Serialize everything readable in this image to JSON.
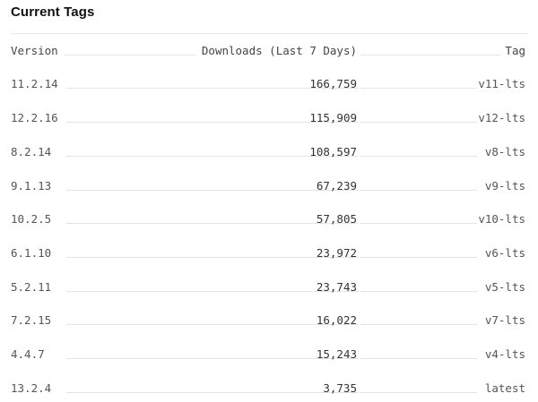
{
  "section": {
    "title": "Current Tags"
  },
  "table": {
    "columns": {
      "version": "Version",
      "downloads": "Downloads (Last 7 Days)",
      "tag": "Tag"
    },
    "rows": [
      {
        "version": "11.2.14",
        "downloads": "166,759",
        "tag": "v11-lts"
      },
      {
        "version": "12.2.16",
        "downloads": "115,909",
        "tag": "v12-lts"
      },
      {
        "version": "8.2.14",
        "downloads": "108,597",
        "tag": "v8-lts"
      },
      {
        "version": "9.1.13",
        "downloads": "67,239",
        "tag": "v9-lts"
      },
      {
        "version": "10.2.5",
        "downloads": "57,805",
        "tag": "v10-lts"
      },
      {
        "version": "6.1.10",
        "downloads": "23,972",
        "tag": "v6-lts"
      },
      {
        "version": "5.2.11",
        "downloads": "23,743",
        "tag": "v5-lts"
      },
      {
        "version": "7.2.15",
        "downloads": "16,022",
        "tag": "v7-lts"
      },
      {
        "version": "4.4.7",
        "downloads": "15,243",
        "tag": "v4-lts"
      },
      {
        "version": "13.2.4",
        "downloads": "3,735",
        "tag": "latest"
      }
    ]
  }
}
